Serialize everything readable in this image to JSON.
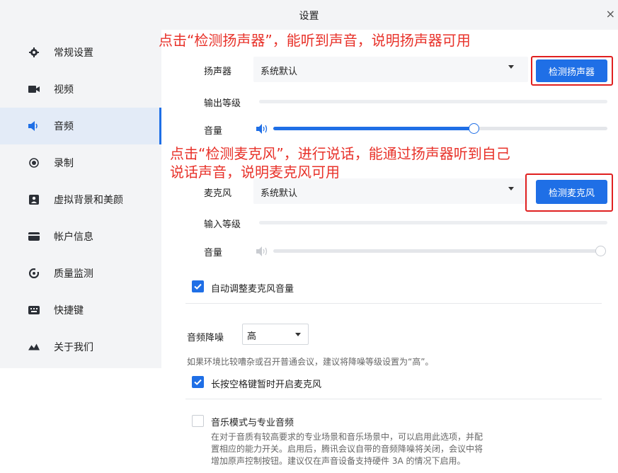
{
  "window": {
    "title": "设置",
    "close_glyph": "×"
  },
  "sidebar": {
    "items": [
      {
        "label": "常规设置",
        "icon": "gear-icon"
      },
      {
        "label": "视频",
        "icon": "video-camera-icon"
      },
      {
        "label": "音频",
        "icon": "speaker-icon",
        "active": true
      },
      {
        "label": "录制",
        "icon": "record-icon"
      },
      {
        "label": "虚拟背景和美颜",
        "icon": "portrait-icon"
      },
      {
        "label": "帐户信息",
        "icon": "card-icon"
      },
      {
        "label": "质量监测",
        "icon": "gauge-icon"
      },
      {
        "label": "快捷键",
        "icon": "keyboard-icon"
      },
      {
        "label": "关于我们",
        "icon": "about-icon"
      }
    ]
  },
  "annotations": {
    "speaker_note": "点击“检测扬声器”，能听到声音，说明扬声器可用",
    "mic_note_line1": "点击“检测麦克风”，进行说话，能通过扬声器听到自己",
    "mic_note_line2": "说话声音，说明麦克风可用"
  },
  "speaker": {
    "label": "扬声器",
    "device": "系统默认",
    "test_button": "检测扬声器",
    "output_level_label": "输出等级",
    "volume_label": "音量",
    "volume_fraction": 0.6
  },
  "microphone": {
    "label": "麦克风",
    "device": "系统默认",
    "test_button": "检测麦克风",
    "input_level_label": "输入等级",
    "volume_label": "音量",
    "volume_fraction": 1.0
  },
  "auto_adjust": {
    "label": "自动调整麦克风音量",
    "checked": true
  },
  "noise": {
    "label": "音频降噪",
    "value": "高",
    "hint": "如果环境比较嘈杂或召开普通会议，建议将降噪等级设置为“高”。"
  },
  "space_unmute": {
    "label": "长按空格键暂时开启麦克风",
    "checked": true
  },
  "music_mode": {
    "label": "音乐模式与专业音频",
    "checked": false,
    "desc_line1": "在对于音质有较高要求的专业场景和音乐场景中，可以启用此选项，并配",
    "desc_line2": "置相应的能力开关。启用后，腾讯会议自带的音频降噪将关闭，会议中将",
    "desc_line3": "增加原声控制按钮。建议仅在声音设备支持硬件 3A 的情况下启用。"
  },
  "colors": {
    "accent": "#1f6fe6",
    "annotation": "#e8322a",
    "sidebar_bg": "#f3f4f6"
  }
}
